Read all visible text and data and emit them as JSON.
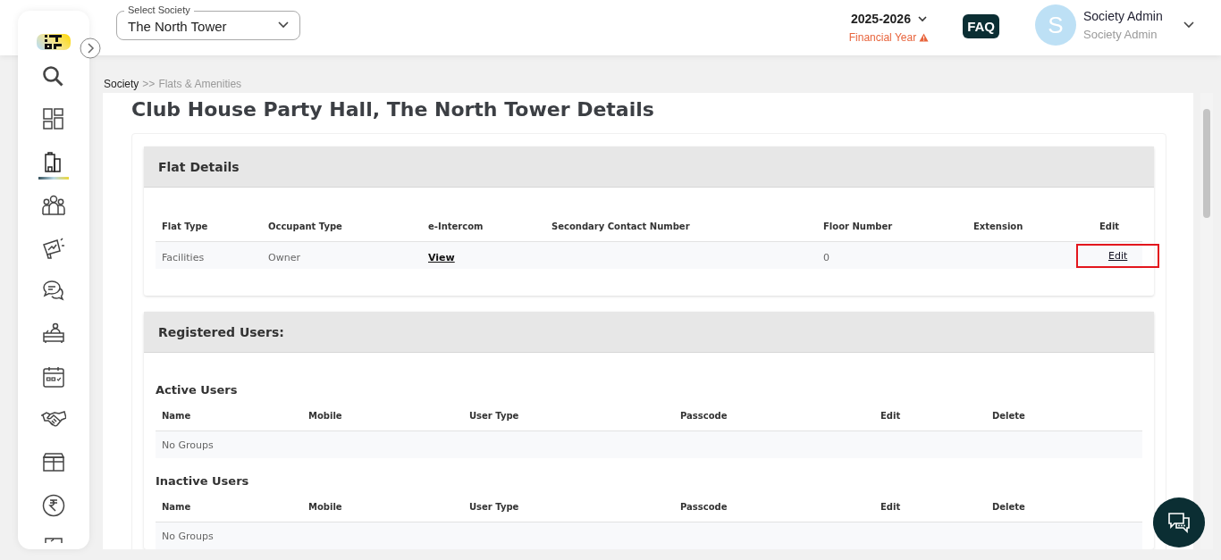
{
  "header": {
    "society_select": {
      "label": "Select Society",
      "value": "The North Tower"
    },
    "financial_year": {
      "value": "2025-2026",
      "label": "Financial Year"
    },
    "faq": "FAQ",
    "user": {
      "initial": "S",
      "name": "Society Admin",
      "role": "Society Admin"
    }
  },
  "sidebar": {
    "items": [
      {
        "selected": false
      },
      {
        "selected": false
      },
      {
        "selected": true
      },
      {
        "selected": false
      },
      {
        "selected": false
      },
      {
        "selected": false
      },
      {
        "selected": false
      },
      {
        "selected": false
      },
      {
        "selected": false
      },
      {
        "selected": false
      },
      {
        "selected": false
      },
      {
        "selected": false
      }
    ]
  },
  "breadcrumb": [
    {
      "label": "Society",
      "current": false
    },
    {
      "label": ">>",
      "current": true
    },
    {
      "label": "Flats & Amenities",
      "current": true
    }
  ],
  "page_title": "Club House Party Hall, The North Tower Details",
  "flat_details": {
    "title": "Flat Details",
    "columns": [
      "Flat Type",
      "Occupant Type",
      "e-Intercom",
      "Secondary Contact Number",
      "Floor Number",
      "Extension",
      "Edit"
    ],
    "rows": [
      {
        "flat_type": "Facilities",
        "occupant_type": "Owner",
        "e_intercom": "View",
        "secondary_contact": "",
        "floor_number": "0",
        "extension": "",
        "edit": "Edit",
        "edit_highlighted": true
      }
    ]
  },
  "registered_users": {
    "title": "Registered Users:",
    "groups": [
      {
        "title": "Active Users",
        "columns": [
          "Name",
          "Mobile",
          "User Type",
          "Passcode",
          "Edit",
          "Delete"
        ],
        "empty_text": "No Groups"
      },
      {
        "title": "Inactive Users",
        "columns": [
          "Name",
          "Mobile",
          "User Type",
          "Passcode",
          "Edit",
          "Delete"
        ],
        "empty_text": "No Groups"
      }
    ]
  }
}
